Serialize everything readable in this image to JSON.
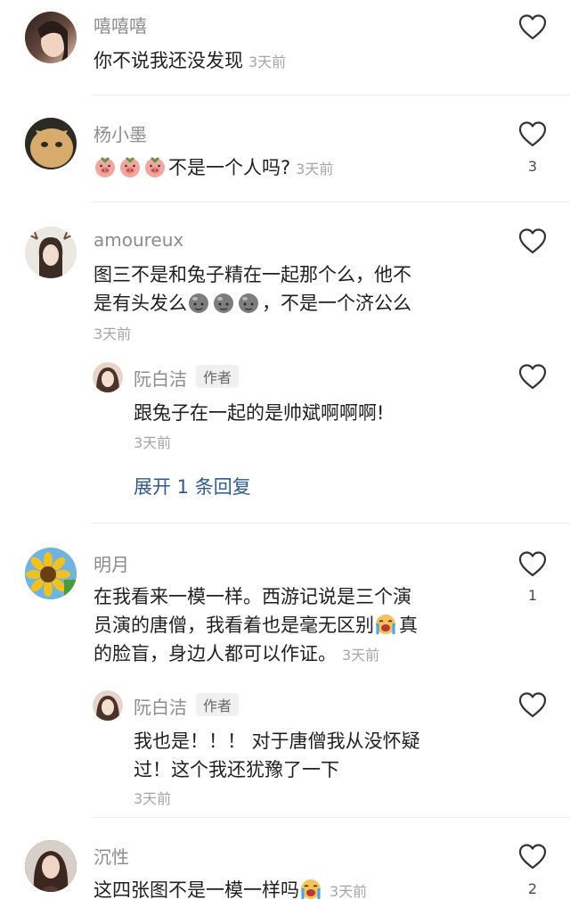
{
  "comments": [
    {
      "user": "嘻嘻嘻",
      "text": "你不说我还没发现",
      "time": "3天前",
      "likes": ""
    },
    {
      "user": "杨小墨",
      "text": "不是一个人吗?",
      "time": "3天前",
      "likes": "3",
      "emoji": "pig-face-emoji"
    },
    {
      "user": "amoureux",
      "text_line1": "图三不是和兔子精在一起那个么，他不",
      "text_line2a": "是有头发么",
      "text_line2b": "，不是一个济公么",
      "time": "3天前",
      "likes": "",
      "emoji": "bald-head-emoji",
      "reply": {
        "user": "阮白洁",
        "tag": "作者",
        "text": "跟兔子在一起的是帅斌啊啊啊!",
        "time": "3天前"
      },
      "expand": "展开 1 条回复"
    },
    {
      "user": "明月",
      "text_line1": "在我看来一模一样。西游记说是三个演",
      "text_line2a": "员演的唐僧，我看着也是毫无区别",
      "text_line2b": "真",
      "text_line3": "的脸盲，身边人都可以作证。",
      "time": "3天前",
      "likes": "1",
      "emoji": "crying-emoji",
      "reply": {
        "user": "阮白洁",
        "tag": "作者",
        "text_line1": "我也是！！！ 对于唐僧我从没怀疑",
        "text_line2": "过！这个我还犹豫了一下",
        "time": "3天前"
      }
    },
    {
      "user": "沉性",
      "text": "这四张图不是一模一样吗",
      "time": "3天前",
      "likes": "2",
      "emoji": "crying-emoji"
    }
  ],
  "colors": {
    "username": "#8c8c8c",
    "link": "#2f5a8f",
    "divider": "#ececec"
  }
}
